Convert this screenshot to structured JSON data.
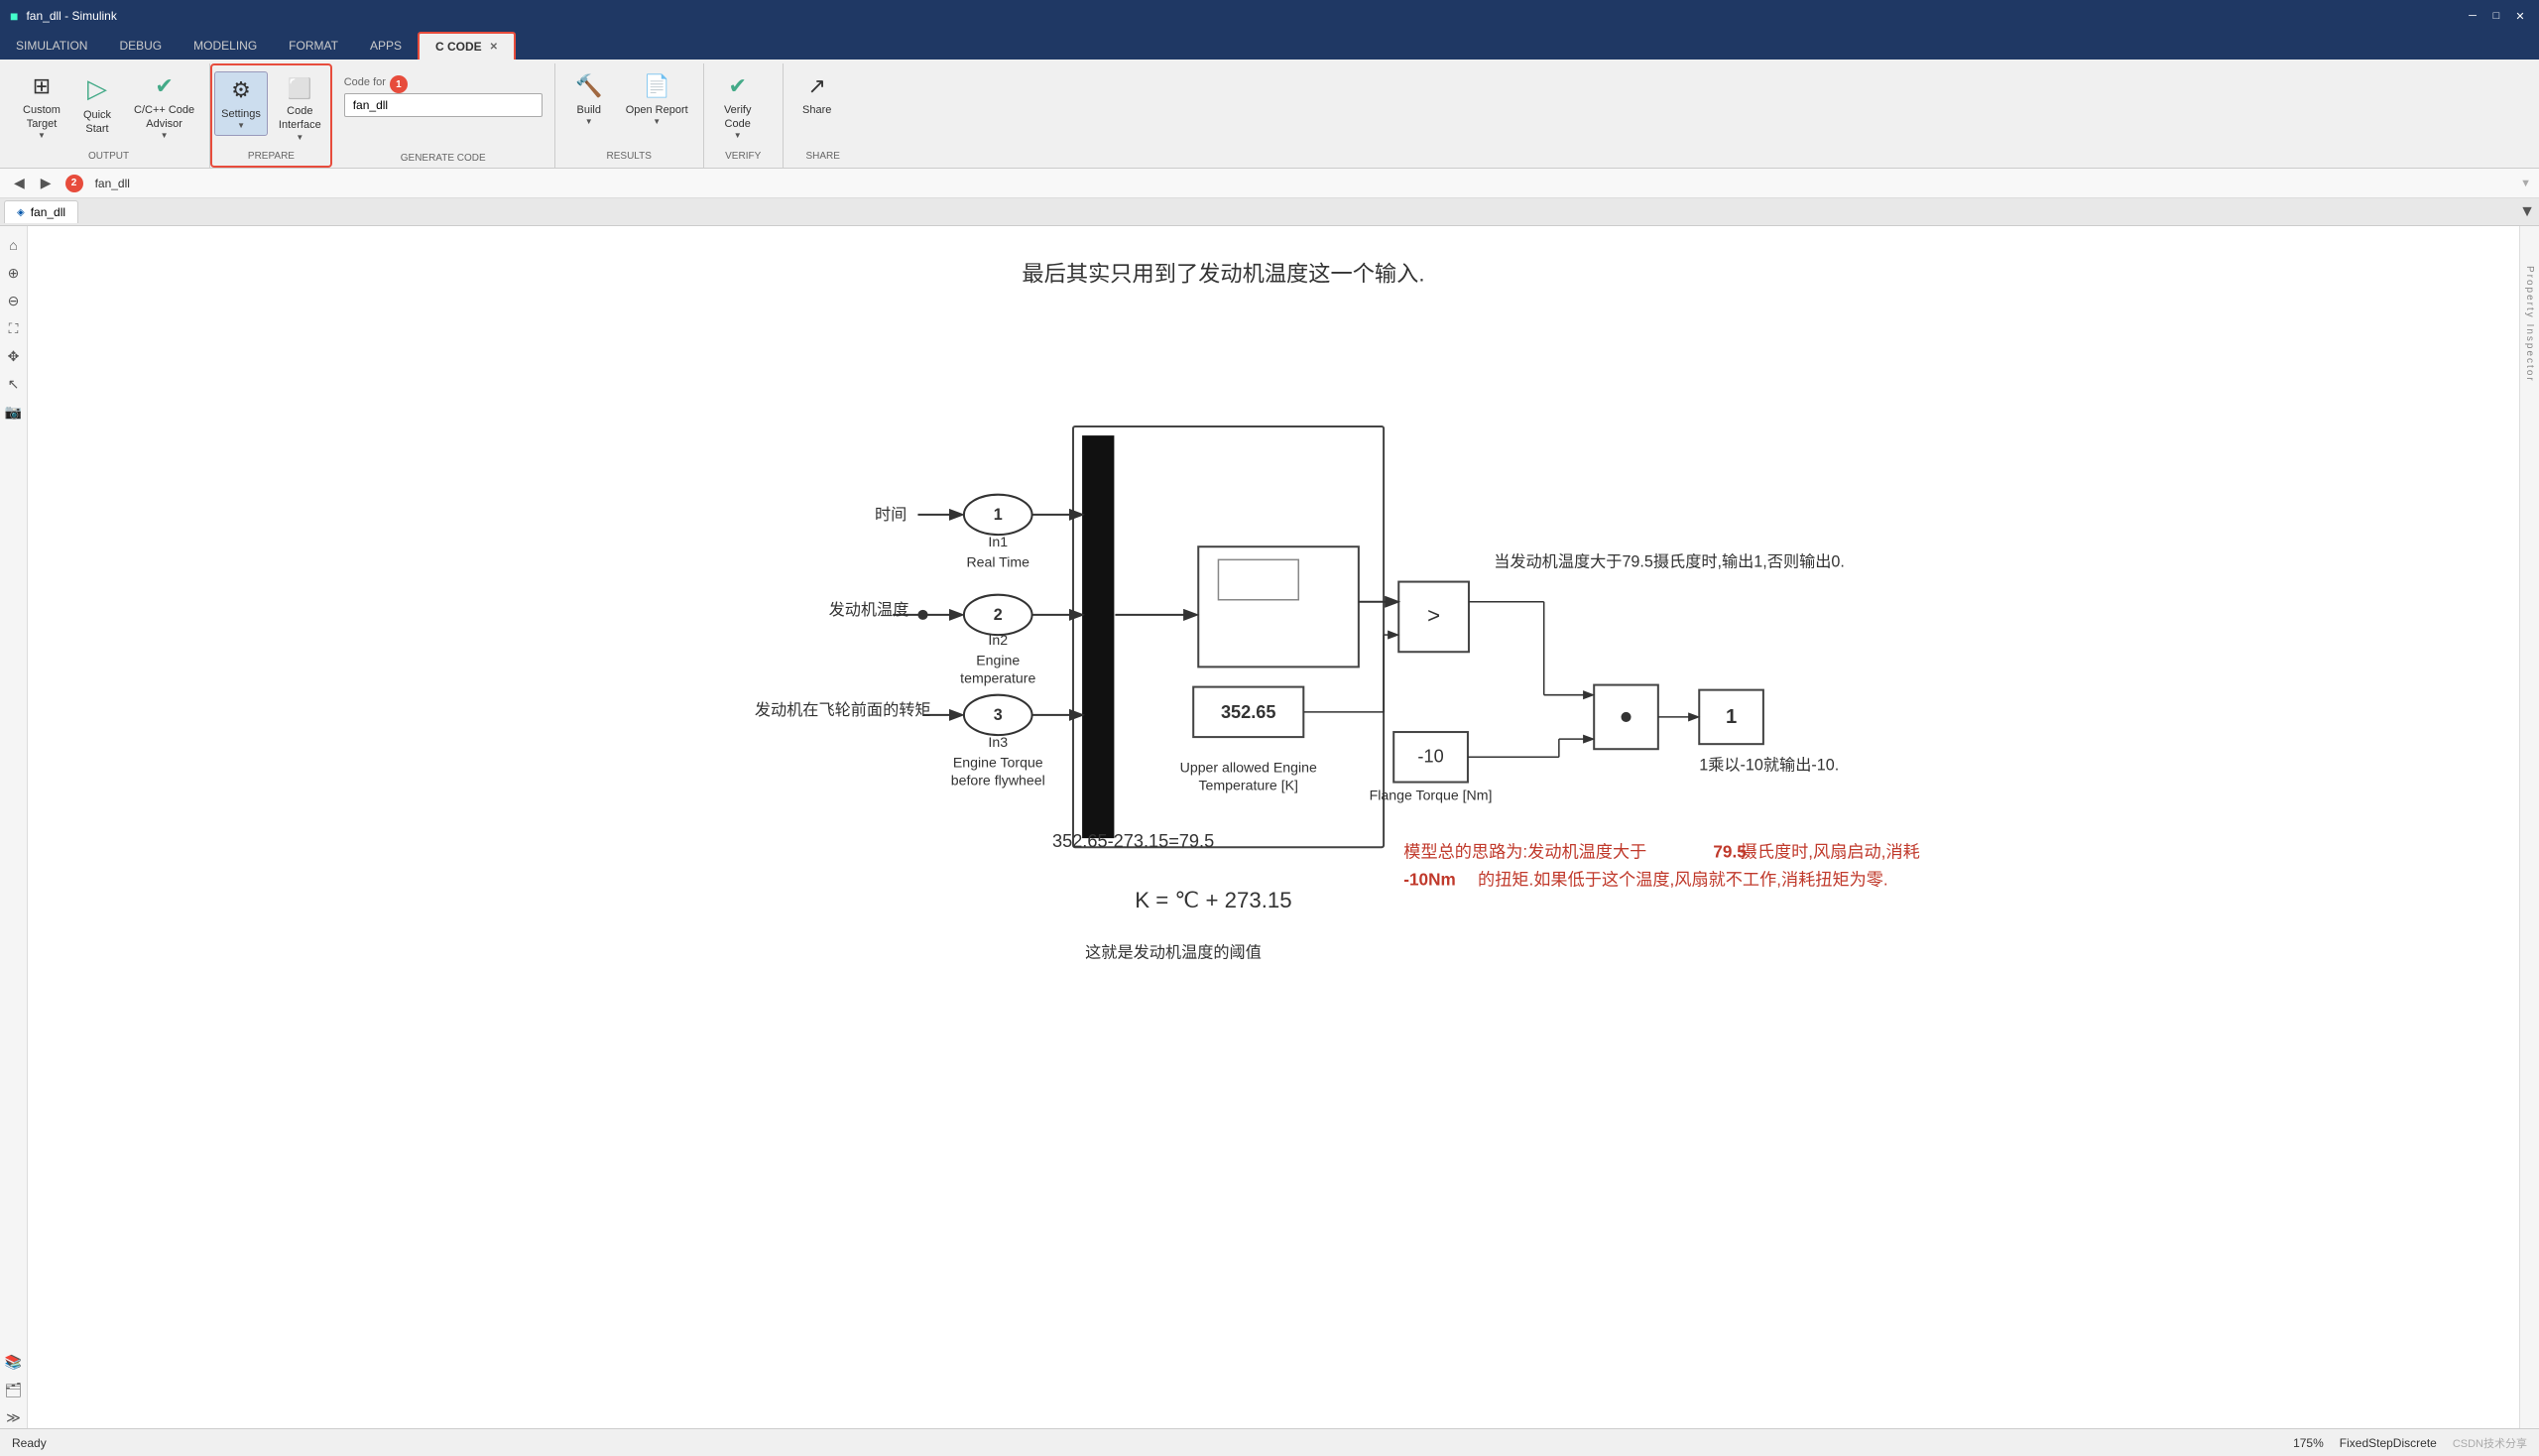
{
  "titlebar": {
    "title": "fan_dll - Simulink",
    "min_btn": "─",
    "max_btn": "□",
    "close_btn": "✕"
  },
  "ribbon": {
    "tabs": [
      {
        "label": "SIMULATION",
        "active": false
      },
      {
        "label": "DEBUG",
        "active": false
      },
      {
        "label": "MODELING",
        "active": false
      },
      {
        "label": "FORMAT",
        "active": false
      },
      {
        "label": "APPS",
        "active": false
      },
      {
        "label": "C CODE",
        "active": true
      }
    ],
    "groups": {
      "output": {
        "label": "OUTPUT",
        "buttons": [
          {
            "label": "Custom\nTarget",
            "icon": "⊞",
            "dropdown": true
          },
          {
            "label": "Quick\nStart",
            "icon": "▷"
          },
          {
            "label": "C/C++ Code\nAdvisor",
            "icon": "✔",
            "dropdown": true
          }
        ]
      },
      "prepare": {
        "label": "PREPARE",
        "highlighted": true,
        "buttons": [
          {
            "label": "Settings",
            "icon": "⚙",
            "dropdown": true
          },
          {
            "label": "Code\nInterface",
            "icon": "⬜",
            "dropdown": true
          }
        ]
      },
      "generate_code": {
        "label": "GENERATE CODE",
        "code_for_label": "Code for",
        "code_for_value": "fan_dll",
        "callout": "1"
      },
      "results": {
        "label": "RESULTS",
        "buttons": [
          {
            "label": "Build",
            "icon": "🔨",
            "dropdown": true
          },
          {
            "label": "Open Report",
            "icon": "📄",
            "dropdown": true
          }
        ]
      },
      "verify": {
        "label": "VERIFY",
        "buttons": [
          {
            "label": "Verify\nCode",
            "icon": "✔",
            "dropdown": true
          }
        ]
      },
      "share": {
        "label": "SHARE",
        "buttons": [
          {
            "label": "Share",
            "icon": "↗"
          }
        ]
      }
    }
  },
  "navbar": {
    "back_btn": "◀",
    "forward_btn": "▶",
    "model_name": "fan_dll",
    "callout": "2",
    "dropdown_arrow": "▼"
  },
  "model_tab": {
    "icon": "◈",
    "label": "fan_dll"
  },
  "diagram": {
    "annotation_top": "最后其实只用到了发动机温度这一个输入.",
    "annotation_eq": "352.65-273.15=79.5",
    "annotation_k": "K = ℃ + 273.15",
    "annotation_threshold": "这就是发动机温度的阈值",
    "annotation_compare": "当发动机温度大于79.5摄氏度时,输出1,否则输出0.",
    "annotation_multiply": "1乘以-10就输出-10.",
    "annotation_summary_start": "模型总的思路为:发动机温度大于",
    "annotation_summary_bold": "79.5",
    "annotation_summary_mid": "摄氏度时,风扇启动,消耗",
    "annotation_summary_red_bold": "-10Nm",
    "annotation_summary_end": "的扭矩.如果低于这个温度,风扇就不工作,消耗扭矩为零.",
    "label_time": "时间",
    "label_engine_temp": "发动机温度",
    "label_engine_torque": "发动机在飞轮前面的转矩",
    "in1_label": "1",
    "in1_name": "In1",
    "in1_desc": "Real Time",
    "in2_label": "2",
    "in2_name": "In2",
    "in2_desc1": "Engine",
    "in2_desc2": "temperature",
    "in3_label": "3",
    "in3_name": "In3",
    "in3_desc1": "Engine Torque",
    "in3_desc2": "before flywheel",
    "constant_value": "352.65",
    "constant_label1": "Upper allowed Engine",
    "constant_label2": "Temperature [K]",
    "compare_op": ">",
    "product_op": "•",
    "gain_value": "-10",
    "gain_label": "Flange Torque [Nm]",
    "out_value": "1"
  },
  "status_bar": {
    "left": "Ready",
    "zoom": "175%",
    "solver": "FixedStepDiscrete",
    "watermark": "CSDN技术分享"
  }
}
